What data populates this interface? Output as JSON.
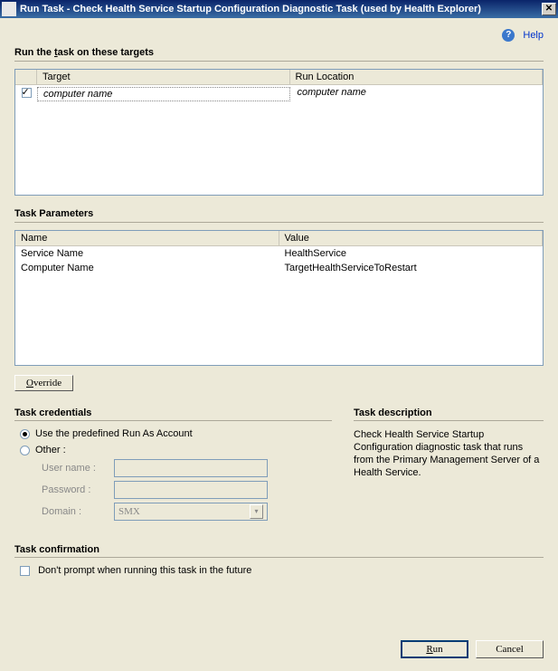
{
  "titlebar": {
    "title": "Run Task - Check Health Service Startup Configuration Diagnostic Task (used by Health Explorer)"
  },
  "help": {
    "label": "Help"
  },
  "targets": {
    "heading_prefix": "Run the ",
    "heading_ul": "t",
    "heading_suffix": "ask on these targets",
    "col_target": "Target",
    "col_location": "Run Location",
    "rows": [
      {
        "checked": true,
        "target": "computer name",
        "location": "computer name"
      }
    ]
  },
  "params": {
    "heading": "Task Parameters",
    "col_name": "Name",
    "col_value": "Value",
    "rows": [
      {
        "name": "Service Name",
        "value": "HealthService"
      },
      {
        "name": "Computer Name",
        "value": "TargetHealthServiceToRestart"
      }
    ]
  },
  "override": {
    "ul": "O",
    "rest": "verride"
  },
  "credentials": {
    "heading": "Task credentials",
    "opt_predefined": "Use the predefined Run As Account",
    "opt_other": "Other :",
    "user_ul": "U",
    "user_rest": "ser name :",
    "pass_ul": "P",
    "pass_rest": "assword :",
    "domain_ul": "D",
    "domain_rest": "omain :",
    "domain_value": "SMX"
  },
  "description": {
    "heading": "Task description",
    "text": "Check Health Service Startup Configuration diagnostic task that runs from the Primary Management Server of a Health Service."
  },
  "confirmation": {
    "heading": "Task confirmation",
    "label": "Don't prompt when running this task in the future"
  },
  "buttons": {
    "run_ul": "R",
    "run_rest": "un",
    "cancel": "Cancel"
  }
}
